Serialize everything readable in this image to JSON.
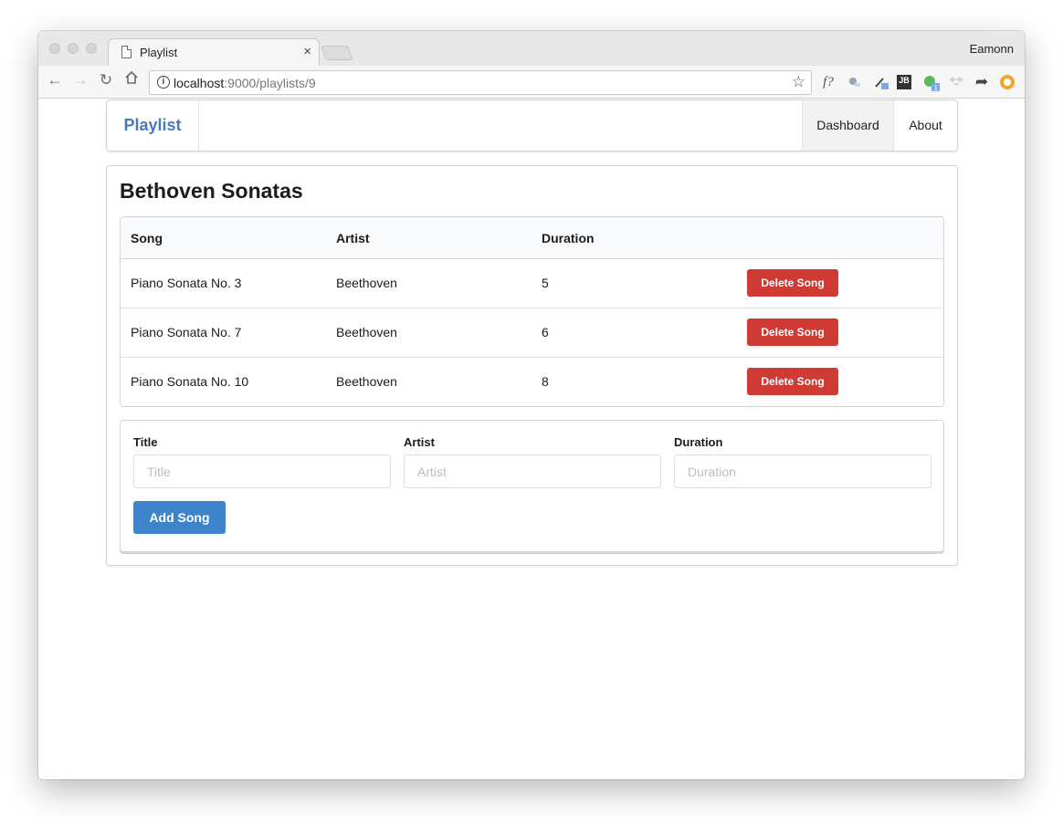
{
  "browser": {
    "tab_title": "Playlist",
    "tab_close": "×",
    "profile_name": "Eamonn",
    "url_host": "localhost",
    "url_path": ":9000/playlists/9",
    "icons": [
      "back-icon",
      "forward-icon",
      "reload-icon",
      "home-icon",
      "info-icon",
      "star-icon"
    ],
    "extensions": [
      "f?",
      "JB",
      "1"
    ]
  },
  "navbar": {
    "brand": "Playlist",
    "brand_color": "#4a7ab8",
    "links": [
      {
        "label": "Dashboard",
        "active": true
      },
      {
        "label": "About",
        "active": false
      }
    ]
  },
  "playlist": {
    "title": "Bethoven Sonatas",
    "columns": [
      "Song",
      "Artist",
      "Duration"
    ],
    "songs": [
      {
        "title": "Piano Sonata No. 3",
        "artist": "Beethoven",
        "duration": "5"
      },
      {
        "title": "Piano Sonata No. 7",
        "artist": "Beethoven",
        "duration": "6"
      },
      {
        "title": "Piano Sonata No. 10",
        "artist": "Beethoven",
        "duration": "8"
      }
    ],
    "delete_label": "Delete Song",
    "delete_color": "#d03a34"
  },
  "form": {
    "title_label": "Title",
    "title_placeholder": "Title",
    "artist_label": "Artist",
    "artist_placeholder": "Artist",
    "duration_label": "Duration",
    "duration_placeholder": "Duration",
    "add_label": "Add Song",
    "add_color": "#3d84cb"
  }
}
